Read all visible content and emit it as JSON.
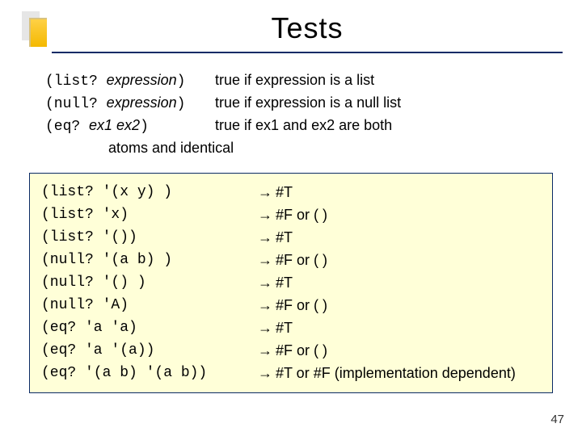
{
  "title": "Tests",
  "defs": [
    {
      "code": "(list? ",
      "arg": "expression",
      "close": ")",
      "desc": "true if expression is a list"
    },
    {
      "code": "(null? ",
      "arg": "expression",
      "close": ")",
      "desc": "true if expression is a null list"
    },
    {
      "code": "(eq? ",
      "arg": "ex1 ex2",
      "close": ")",
      "desc": "true if ex1 and ex2 are both"
    }
  ],
  "defs_cont": "atoms and identical",
  "examples": [
    {
      "expr": "(list? '(x y) )",
      "res": "#T"
    },
    {
      "expr": "(list? 'x)",
      "res": "#F or ( )"
    },
    {
      "expr": "(list? '())",
      "res": "#T"
    },
    {
      "expr": "(null? '(a b) )",
      "res": "#F or ( )"
    },
    {
      "expr": "(null? '() )",
      "res": "#T"
    },
    {
      "expr": "(null? 'A)",
      "res": "#F or ( )"
    },
    {
      "expr": "(eq? 'a 'a)",
      "res": "#T"
    },
    {
      "expr": "(eq? 'a '(a))",
      "res": "#F or ( )"
    },
    {
      "expr": "(eq? '(a b) '(a b))",
      "res": "#T or #F (implementation dependent)"
    }
  ],
  "arrow": "→",
  "pagenum": "47"
}
